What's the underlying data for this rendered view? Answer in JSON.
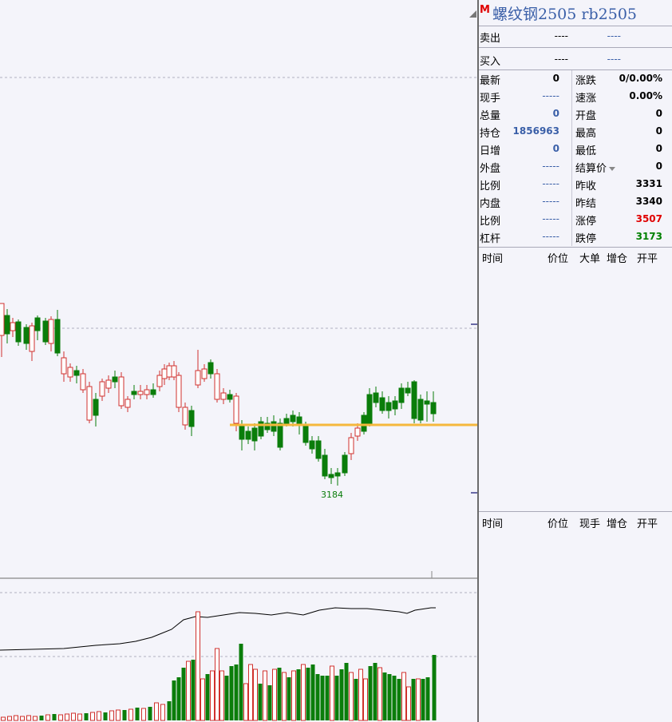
{
  "header": {
    "badge": "M",
    "title": "螺纹钢2505 rb2505"
  },
  "orderbook": {
    "sell": {
      "label": "卖出",
      "price": "----",
      "vol": "----"
    },
    "buy": {
      "label": "买入",
      "price": "----",
      "vol": "----"
    }
  },
  "quote_left": [
    {
      "label": "最新",
      "value": "0",
      "color": "black"
    },
    {
      "label": "现手",
      "value": "-----",
      "color": "blue"
    },
    {
      "label": "总量",
      "value": "0",
      "color": "blue"
    },
    {
      "label": "持仓",
      "value": "1856963",
      "color": "blue"
    },
    {
      "label": "日增",
      "value": "0",
      "color": "blue"
    },
    {
      "label": "外盘",
      "value": "-----",
      "color": "blue"
    },
    {
      "label": "比例",
      "value": "-----",
      "color": "blue"
    },
    {
      "label": "内盘",
      "value": "-----",
      "color": "blue"
    },
    {
      "label": "比例",
      "value": "-----",
      "color": "blue"
    },
    {
      "label": "杠杆",
      "value": "-----",
      "color": "blue"
    }
  ],
  "quote_right": [
    {
      "label": "涨跌",
      "value": "0/0.00%",
      "color": "black"
    },
    {
      "label": "速涨",
      "value": "0.00%",
      "color": "black"
    },
    {
      "label": "开盘",
      "value": "0",
      "color": "black"
    },
    {
      "label": "最高",
      "value": "0",
      "color": "black"
    },
    {
      "label": "最低",
      "value": "0",
      "color": "black"
    },
    {
      "label": "结算价",
      "value": "0",
      "color": "black"
    },
    {
      "label": "昨收",
      "value": "3331",
      "color": "black"
    },
    {
      "label": "昨结",
      "value": "3340",
      "color": "black"
    },
    {
      "label": "涨停",
      "value": "3507",
      "color": "red"
    },
    {
      "label": "跌停",
      "value": "3173",
      "color": "green"
    }
  ],
  "tick_table_1": {
    "headers": [
      "时间",
      "价位",
      "大单",
      "增仓",
      "开平"
    ]
  },
  "tick_table_2": {
    "headers": [
      "时间",
      "价位",
      "现手",
      "增仓",
      "开平"
    ]
  },
  "chart_data": {
    "type": "candlestick",
    "annotations": [
      "3184"
    ],
    "horizontal_line_color": "#f5b83d",
    "up_color": "#d0312d",
    "down_color": "#0a7d0a"
  }
}
